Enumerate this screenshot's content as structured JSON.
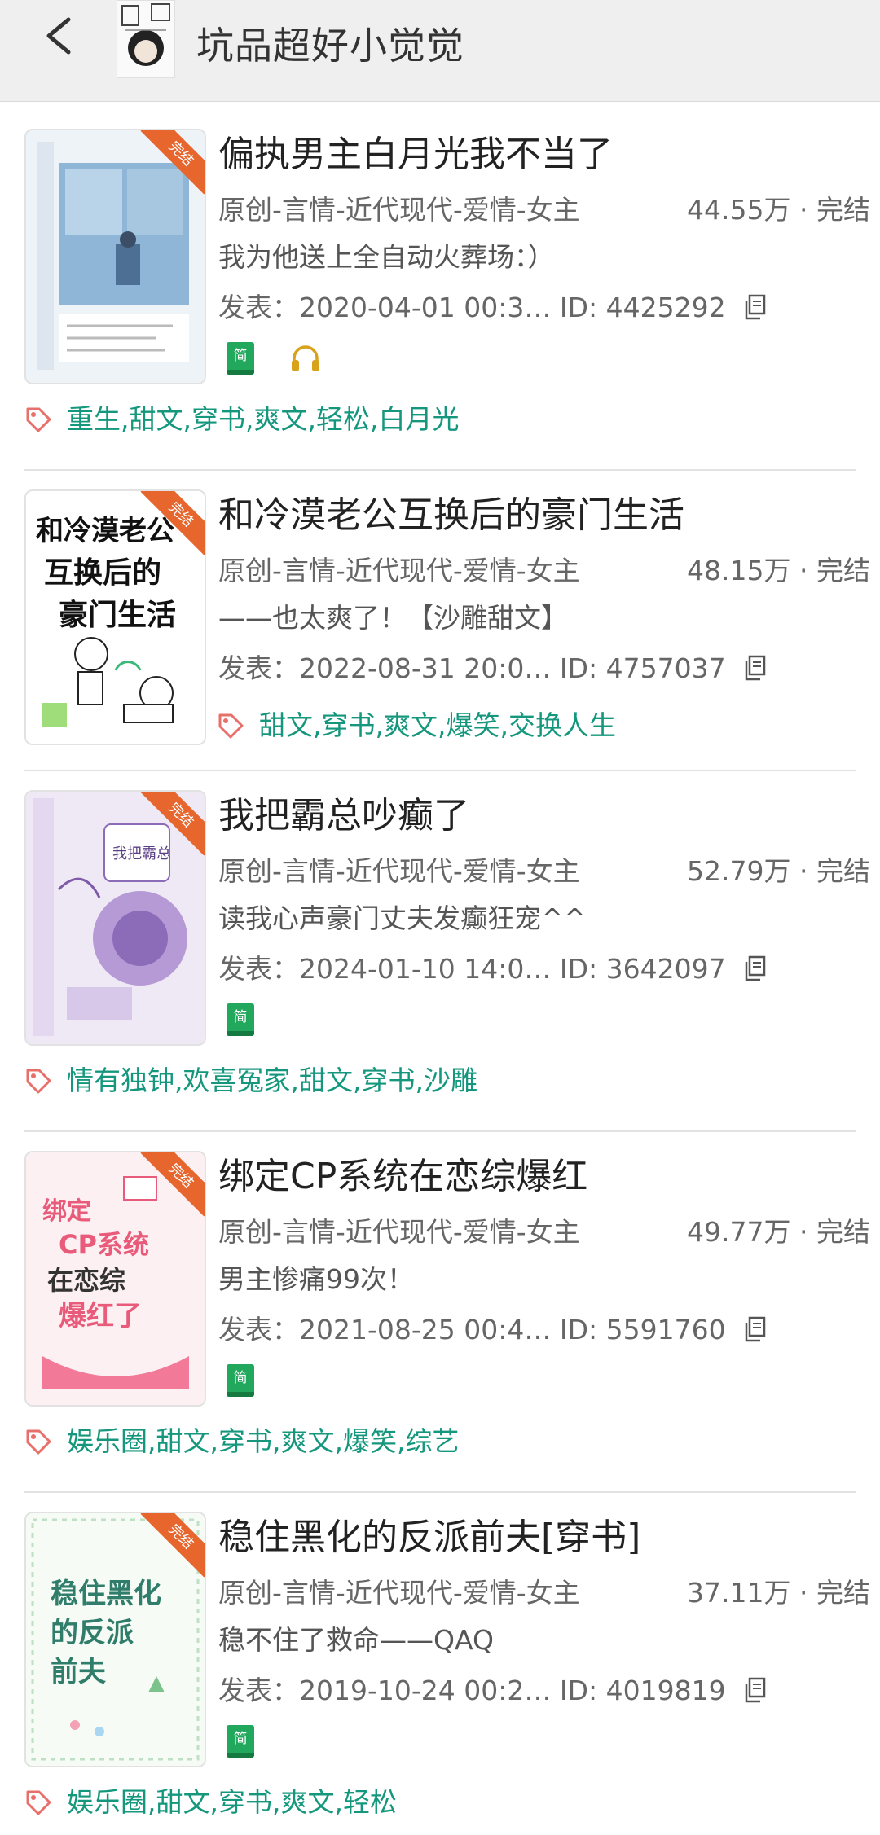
{
  "header": {
    "title": "坑品超好小觉觉",
    "back_icon": "chevron-left-icon",
    "avatar_icon": "author-avatar"
  },
  "colors": {
    "header_bg": "#efefef",
    "tag_text": "#14977d",
    "badge": "#e7662d",
    "simplified_icon": "#22a85c",
    "audio_icon": "#d8a21a",
    "tag_icon": "#e8706a"
  },
  "books": [
    {
      "badge": "完结",
      "title": "偏执男主白月光我不当了",
      "meta": "原创-言情-近代现代-爱情-女主",
      "count_status": "44.55万 · 完结",
      "summary": "我为他送上全自动火葬场：）",
      "date": "发表：2020-04-01 00:3…",
      "id": "ID: 4425292",
      "simplified_label": "简",
      "has_audio": true,
      "tags": "重生,甜文,穿书,爽文,轻松,白月光"
    },
    {
      "badge": "完结",
      "title": "和冷漠老公互换后的豪门生活",
      "meta": "原创-言情-近代现代-爱情-女主",
      "count_status": "48.15万 · 完结",
      "summary": "——也太爽了！【沙雕甜文】",
      "date": "发表：2022-08-31 20:0…",
      "id": "ID: 4757037",
      "simplified_label": "",
      "has_audio": false,
      "tags": "甜文,穿书,爽文,爆笑,交换人生"
    },
    {
      "badge": "完结",
      "title": "我把霸总吵癫了",
      "meta": "原创-言情-近代现代-爱情-女主",
      "count_status": "52.79万 · 完结",
      "summary": "读我心声豪门丈夫发癫狂宠^^",
      "date": "发表：2024-01-10 14:0…",
      "id": "ID: 3642097",
      "simplified_label": "简",
      "has_audio": false,
      "tags": "情有独钟,欢喜冤家,甜文,穿书,沙雕"
    },
    {
      "badge": "完结",
      "title": "绑定CP系统在恋综爆红",
      "meta": "原创-言情-近代现代-爱情-女主",
      "count_status": "49.77万 · 完结",
      "summary": "男主惨痛99次！",
      "date": "发表：2021-08-25 00:4…",
      "id": "ID: 5591760",
      "simplified_label": "简",
      "has_audio": false,
      "tags": "娱乐圈,甜文,穿书,爽文,爆笑,综艺"
    },
    {
      "badge": "完结",
      "title": "稳住黑化的反派前夫[穿书]",
      "meta": "原创-言情-近代现代-爱情-女主",
      "count_status": "37.11万 · 完结",
      "summary": "稳不住了救命——QAQ",
      "date": "发表：2019-10-24 00:2…",
      "id": "ID: 4019819",
      "simplified_label": "简",
      "has_audio": false,
      "tags": "娱乐圈,甜文,穿书,爽文,轻松"
    }
  ]
}
